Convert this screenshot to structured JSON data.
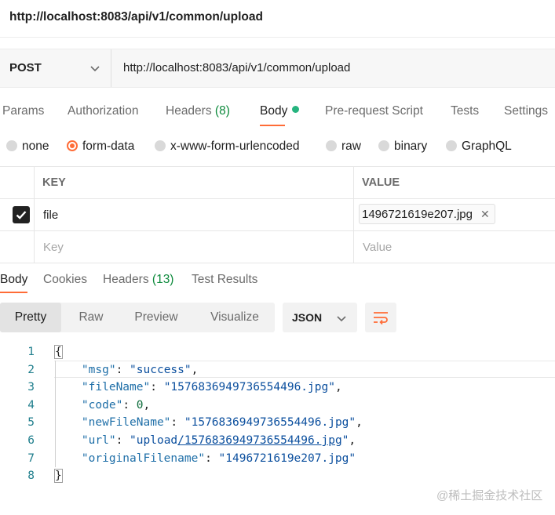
{
  "header": {
    "title": "http://localhost:8083/api/v1/common/upload"
  },
  "request": {
    "method": "POST",
    "url": "http://localhost:8083/api/v1/common/upload"
  },
  "request_tabs": [
    {
      "label": "Params"
    },
    {
      "label": "Authorization"
    },
    {
      "label": "Headers",
      "count": "(8)"
    },
    {
      "label": "Body",
      "active": true
    },
    {
      "label": "Pre-request Script"
    },
    {
      "label": "Tests"
    },
    {
      "label": "Settings"
    }
  ],
  "body_types": [
    {
      "label": "none"
    },
    {
      "label": "form-data",
      "selected": true
    },
    {
      "label": "x-www-form-urlencoded"
    },
    {
      "label": "raw"
    },
    {
      "label": "binary"
    },
    {
      "label": "GraphQL"
    }
  ],
  "form_table": {
    "headers": {
      "key": "KEY",
      "value": "VALUE"
    },
    "rows": [
      {
        "key": "file",
        "value": "1496721619e207.jpg",
        "checked": true
      }
    ],
    "placeholders": {
      "key": "Key",
      "value": "Value"
    }
  },
  "response_tabs": [
    {
      "label": "Body",
      "active": true
    },
    {
      "label": "Cookies"
    },
    {
      "label": "Headers",
      "count": "(13)"
    },
    {
      "label": "Test Results"
    }
  ],
  "view_modes": [
    {
      "label": "Pretty",
      "active": true
    },
    {
      "label": "Raw"
    },
    {
      "label": "Preview"
    },
    {
      "label": "Visualize"
    }
  ],
  "format": "JSON",
  "response_lines": [
    {
      "n": "1",
      "text": "{"
    },
    {
      "n": "2",
      "key": "\"msg\"",
      "value": "\"success\"",
      "comma": ","
    },
    {
      "n": "3",
      "key": "\"fileName\"",
      "value": "\"1576836949736554496.jpg\"",
      "comma": ","
    },
    {
      "n": "4",
      "key": "\"code\"",
      "value": "0",
      "comma": ","
    },
    {
      "n": "5",
      "key": "\"newFileName\"",
      "value": "\"1576836949736554496.jpg\"",
      "comma": ","
    },
    {
      "n": "6",
      "key": "\"url\"",
      "value_pre": "\"upload",
      "value_link": "/1576836949736554496.jpg",
      "value_post": "\"",
      "comma": ","
    },
    {
      "n": "7",
      "key": "\"originalFilename\"",
      "value": "\"1496721619e207.jpg\""
    },
    {
      "n": "8",
      "text": "}"
    }
  ],
  "watermark": "@稀土掘金技术社区",
  "colors": {
    "accent": "#ff6c37",
    "status_green": "#26b47f",
    "count_green": "#0d8a3c"
  }
}
